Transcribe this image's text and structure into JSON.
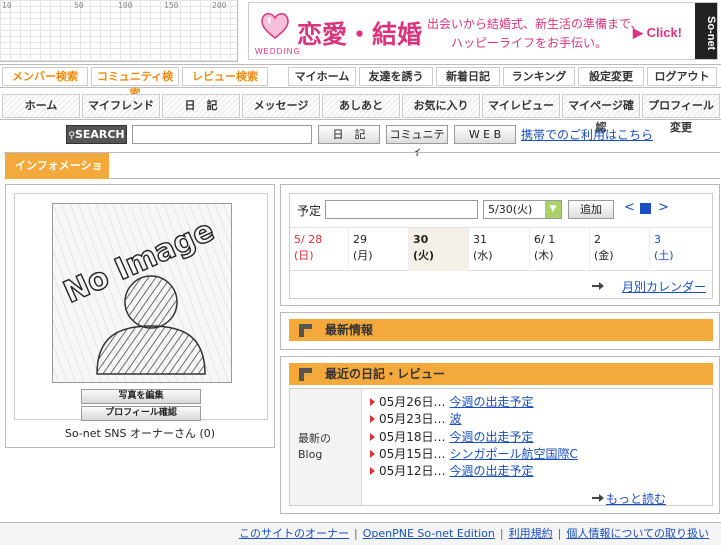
{
  "ruler": {
    "labels": [
      "10",
      "50",
      "100",
      "150",
      "200"
    ]
  },
  "ad": {
    "tag": "WEDDING",
    "title": "恋愛・結婚",
    "copy_line1": "出会いから結婚式、新生活の準備まで、",
    "copy_line2": "ハッピーライフをお手伝い。",
    "click": "▶ Click!",
    "logo": "So-net"
  },
  "nav1": {
    "member_search": "メンバー検索",
    "community_search": "コミュニティ検索",
    "review_search": "レビュー検索",
    "my_home": "マイホーム",
    "invite": "友達を誘う",
    "new_diary": "新着日記",
    "ranking": "ランキング",
    "settings": "設定変更",
    "logout": "ログアウト"
  },
  "nav2": {
    "home": "ホーム",
    "my_friends": "マイフレンド",
    "diary": "日　記",
    "message": "メッセージ",
    "footprints": "あしあと",
    "favorites": "お気に入り",
    "my_review": "マイレビュー",
    "mypage_check": "マイページ確認",
    "profile_edit": "プロフィール変更"
  },
  "search": {
    "button": "SEARCH",
    "diary": "日　記",
    "community": "コミュニティ",
    "web": "W E B",
    "mobile_link": "携帯でのご利用はこちら"
  },
  "info_tab": "インフォメーション",
  "profile": {
    "edit_photo": "写真を編集",
    "profile_check": "プロフィール確認",
    "owner_name": "So-net SNS オーナーさん (0)",
    "no_image": "No Image"
  },
  "schedule": {
    "label": "予定",
    "date_select": "5/30(火)",
    "add_button": "追加",
    "prev": "<",
    "next": ">",
    "days": [
      {
        "date": "5/ 28",
        "dow": "(日)",
        "color": "#d83030"
      },
      {
        "date": "29",
        "dow": "(月)",
        "color": "#222222"
      },
      {
        "date": "30",
        "dow": "(火)",
        "color": "#222222"
      },
      {
        "date": "31",
        "dow": "(水)",
        "color": "#222222"
      },
      {
        "date": "6/ 1",
        "dow": "(木)",
        "color": "#222222"
      },
      {
        "date": "2",
        "dow": "(金)",
        "color": "#222222"
      },
      {
        "date": "3",
        "dow": "(土)",
        "color": "#1a4fc2"
      }
    ],
    "monthly_link": "月別カレンダー"
  },
  "latest_info": {
    "title": "最新情報"
  },
  "recent": {
    "title": "最近の日記・レビュー",
    "side_label_1": "最新の",
    "side_label_2": "Blog",
    "entries": [
      {
        "date": "05月26日…",
        "title": "今週の出走予定"
      },
      {
        "date": "05月23日…",
        "title": "波"
      },
      {
        "date": "05月18日…",
        "title": "今週の出走予定"
      },
      {
        "date": "05月15日…",
        "title": "シンガポール航空国際C"
      },
      {
        "date": "05月12日…",
        "title": "今週の出走予定"
      }
    ],
    "read_more": "もっと読む"
  },
  "footer": {
    "owner": "このサイトのオーナー",
    "edition": "OpenPNE So-net Edition",
    "terms": "利用規約",
    "privacy": "個人情報についての取り扱い",
    "separator": "|"
  }
}
